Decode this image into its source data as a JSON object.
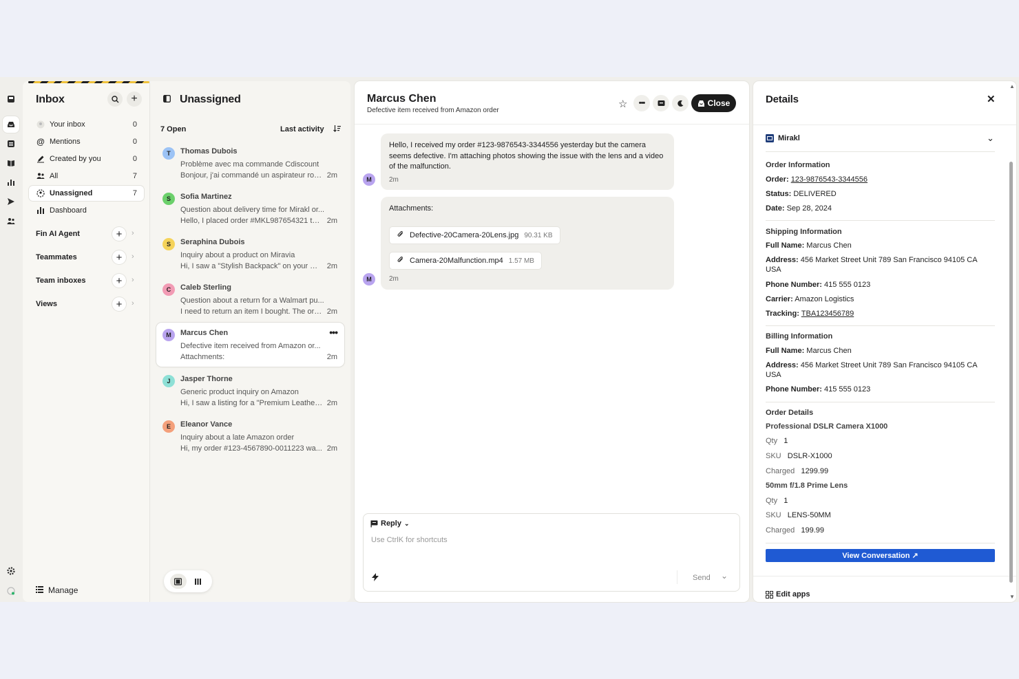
{
  "sidebar": {
    "title": "Inbox",
    "items": [
      {
        "label": "Your inbox",
        "count": "0",
        "icon": "user-circle-icon"
      },
      {
        "label": "Mentions",
        "count": "0",
        "icon": "at-icon"
      },
      {
        "label": "Created by you",
        "count": "0",
        "icon": "pen-icon"
      },
      {
        "label": "All",
        "count": "7",
        "icon": "people-icon"
      },
      {
        "label": "Unassigned",
        "count": "7",
        "icon": "unassigned-icon"
      },
      {
        "label": "Dashboard",
        "count": "",
        "icon": "bar-chart-icon"
      }
    ],
    "sections": [
      "Fin AI Agent",
      "Teammates",
      "Team inboxes",
      "Views"
    ],
    "manage_label": "Manage"
  },
  "list": {
    "title": "Unassigned",
    "open_count": "7 Open",
    "sort_label": "Last activity",
    "conversations": [
      {
        "initial": "T",
        "name": "Thomas Dubois",
        "subject": "Problème avec ma commande Cdiscount",
        "preview": "Bonjour, j'ai commandé un aspirateur rob...",
        "time": "2m",
        "color": "#9cc3f5"
      },
      {
        "initial": "S",
        "name": "Sofia Martinez",
        "subject": "Question about delivery time for Mirakl or...",
        "preview": "Hello, I placed order #MKL987654321 thr...",
        "time": "2m",
        "color": "#6bd06b"
      },
      {
        "initial": "S",
        "name": "Seraphina Dubois",
        "subject": "Inquiry about a product on Miravia",
        "preview": "Hi, I saw a \"Stylish Backpack\" on your Mi...",
        "time": "2m",
        "color": "#f5d35a"
      },
      {
        "initial": "C",
        "name": "Caleb Sterling",
        "subject": "Question about a return for a Walmart pu...",
        "preview": "I need to return an item I bought. The ord...",
        "time": "2m",
        "color": "#f29bb4"
      },
      {
        "initial": "M",
        "name": "Marcus Chen",
        "subject": "Defective item received from Amazon or...",
        "preview": "Attachments:",
        "time": "2m",
        "color": "#b9a4ef"
      },
      {
        "initial": "J",
        "name": "Jasper Thorne",
        "subject": "Generic product inquiry on Amazon",
        "preview": "Hi, I saw a listing for a \"Premium Leather ...",
        "time": "2m",
        "color": "#8ee0d6"
      },
      {
        "initial": "E",
        "name": "Eleanor Vance",
        "subject": "Inquiry about a late Amazon order",
        "preview": "Hi, my order #123-4567890-0011223 wa...",
        "time": "2m",
        "color": "#f4a07b"
      }
    ]
  },
  "chat": {
    "name": "Marcus Chen",
    "subject": "Defective item received from Amazon order",
    "close_label": "Close",
    "message1": "Hello, I received my order #123-9876543-3344556 yesterday but the camera seems defective. I'm attaching photos showing the issue with the lens and a video of the malfunction.",
    "message1_time": "2m",
    "attachments_label": "Attachments:",
    "attachments": [
      {
        "name": "Defective-20Camera-20Lens.jpg",
        "size": "90.31 KB"
      },
      {
        "name": "Camera-20Malfunction.mp4",
        "size": "1.57 MB"
      }
    ],
    "message2_time": "2m",
    "avatar_initial": "M",
    "reply_label": "Reply",
    "reply_placeholder": "Use CtrlK for shortcuts",
    "send_label": "Send"
  },
  "details": {
    "title": "Details",
    "app_name": "Mirakl",
    "order_info": {
      "heading": "Order Information",
      "order_label": "Order:",
      "order": "123-9876543-3344556",
      "status_label": "Status:",
      "status": "DELIVERED",
      "date_label": "Date:",
      "date": "Sep 28, 2024"
    },
    "shipping": {
      "heading": "Shipping Information",
      "name_label": "Full Name:",
      "name": "Marcus Chen",
      "address_label": "Address:",
      "address1": "456 Market Street Unit 789 San Francisco 94105 CA",
      "address2": "USA",
      "phone_label": "Phone Number:",
      "phone": "415 555 0123",
      "carrier_label": "Carrier:",
      "carrier": "Amazon Logistics",
      "tracking_label": "Tracking:",
      "tracking": "TBA123456789"
    },
    "billing": {
      "heading": "Billing Information",
      "name_label": "Full Name:",
      "name": "Marcus Chen",
      "address_label": "Address:",
      "address1": "456 Market Street Unit 789 San Francisco 94105 CA",
      "address2": "USA",
      "phone_label": "Phone Number:",
      "phone": "415 555 0123"
    },
    "order_details": {
      "heading": "Order Details",
      "items": [
        {
          "name": "Professional DSLR Camera X1000",
          "qty_label": "Qty",
          "qty": "1",
          "sku_label": "SKU",
          "sku": "DSLR-X1000",
          "charged_label": "Charged",
          "charged": "1299.99"
        },
        {
          "name": "50mm f/1.8 Prime Lens",
          "qty_label": "Qty",
          "qty": "1",
          "sku_label": "SKU",
          "sku": "LENS-50MM",
          "charged_label": "Charged",
          "charged": "199.99"
        }
      ]
    },
    "view_conversation": "View Conversation ↗",
    "edit_apps": "Edit apps",
    "accent": "#1f5ad3"
  }
}
